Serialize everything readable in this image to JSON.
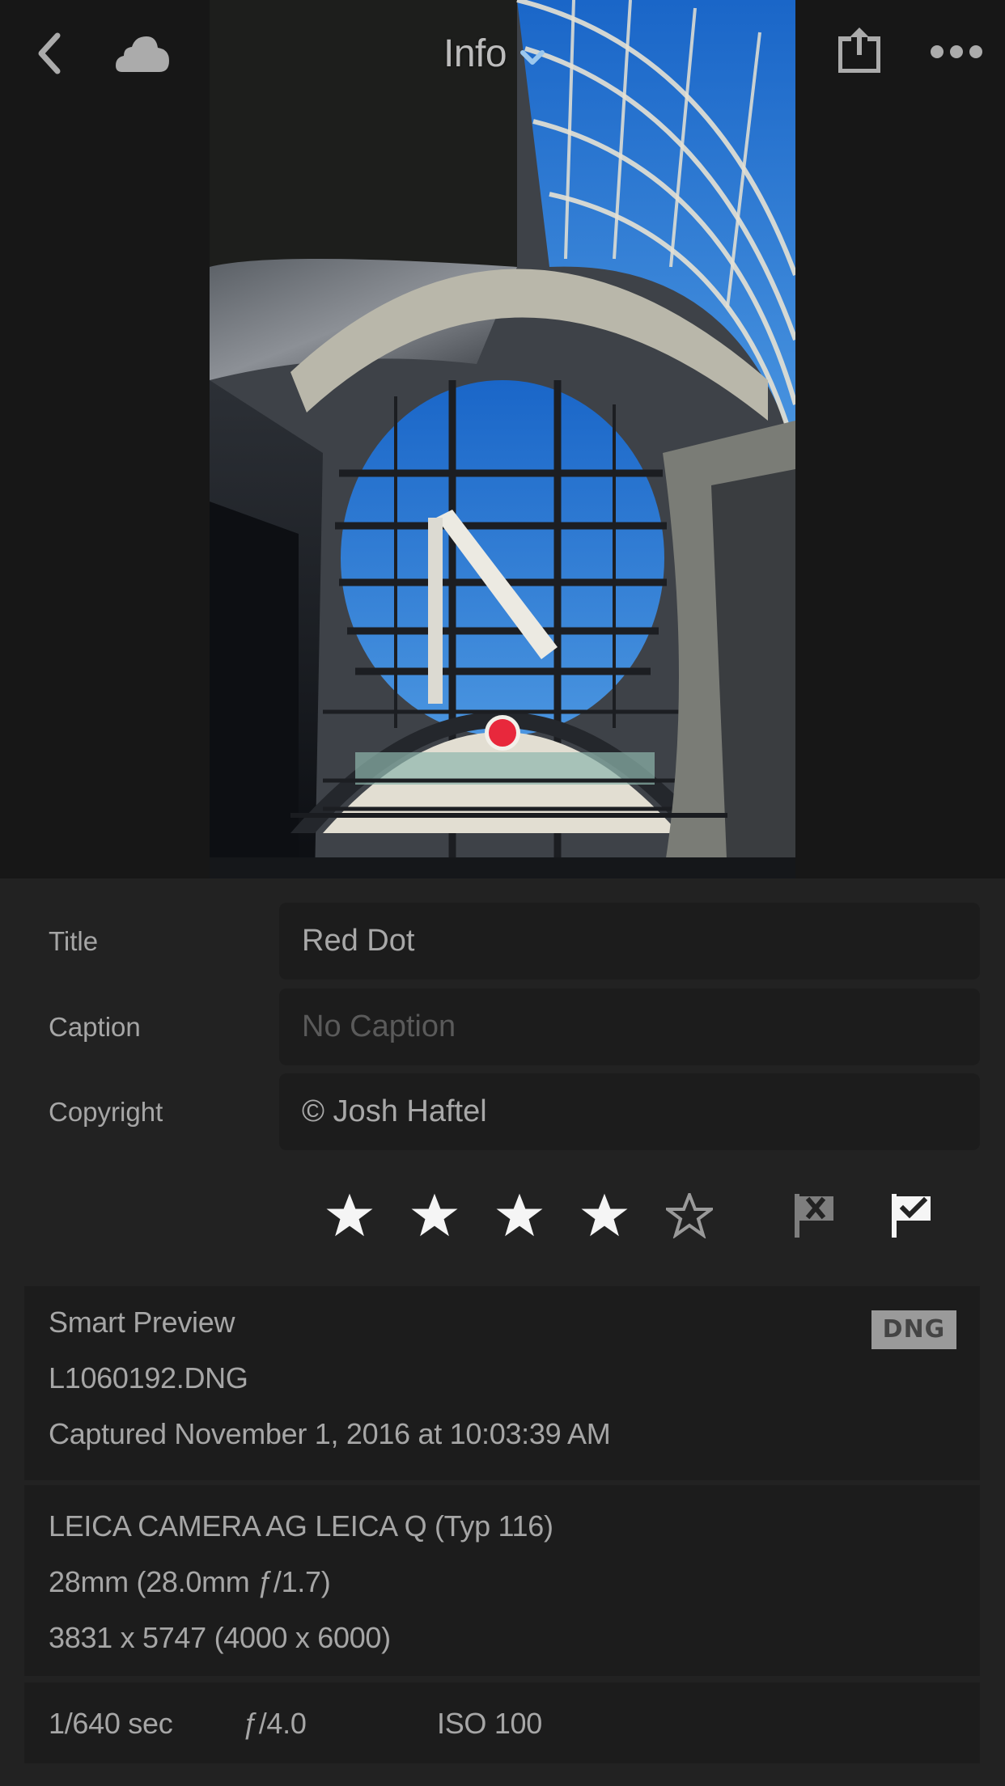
{
  "header": {
    "title": "Info",
    "icons": {
      "back": "chevron-left-icon",
      "cloud": "cloud-icon",
      "title_dropdown": "chevron-down-icon",
      "share": "share-icon",
      "more": "more-horizontal-icon"
    }
  },
  "photo": {
    "subject": "Glass-domed atrium with circular window and red dot",
    "accent_color": "#e8283c"
  },
  "metadata": {
    "fields": [
      {
        "label": "Title",
        "value": "Red Dot",
        "placeholder": ""
      },
      {
        "label": "Caption",
        "value": "",
        "placeholder": "No Caption"
      },
      {
        "label": "Copyright",
        "value": "© Josh Haftel",
        "placeholder": ""
      }
    ]
  },
  "rating": {
    "value": 4,
    "max": 5
  },
  "flags": {
    "reject": {
      "label": "Reject flag",
      "active": false
    },
    "pick": {
      "label": "Pick flag",
      "active": true
    }
  },
  "file_info": {
    "preview_type": "Smart Preview",
    "filename": "L1060192.DNG",
    "captured": "Captured November 1, 2016 at 10:03:39 AM",
    "format_badge": "DNG"
  },
  "camera_info": {
    "camera": "LEICA CAMERA AG LEICA Q (Typ 116)",
    "lens": "28mm (28.0mm ƒ/1.7)",
    "dimensions": "3831 x 5747 (4000 x 6000)"
  },
  "exposure": {
    "shutter": "1/640 sec",
    "aperture": "ƒ/4.0",
    "iso": "ISO 100"
  },
  "colors": {
    "background": "#222222",
    "topbar": "#171717",
    "field_bg": "#1c1c1c",
    "text": "#a6a6a6",
    "star_filled": "#f5f5f5",
    "star_empty": "#9a9a9a",
    "flag_pick": "#f5f5f5",
    "flag_reject": "#808080",
    "badge_bg": "#9a9a9a"
  }
}
